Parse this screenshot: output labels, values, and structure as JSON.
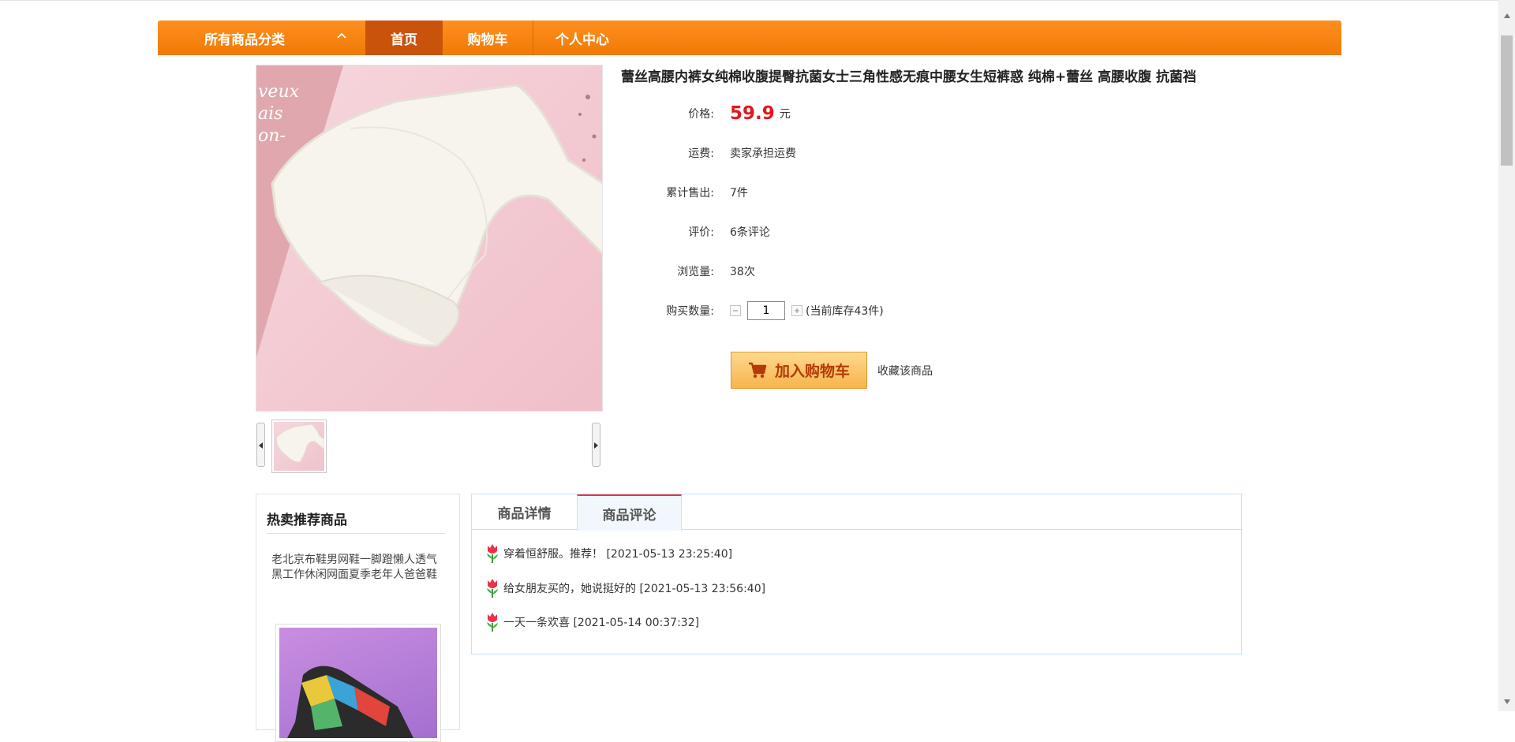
{
  "nav": {
    "category_label": "所有商品分类",
    "items": [
      {
        "label": "首页"
      },
      {
        "label": "购物车"
      },
      {
        "label": "个人中心"
      }
    ]
  },
  "product": {
    "title": "蕾丝高腰内裤女纯棉收腹提臀抗菌女士三角性感无痕中腰女生短裤惑 纯棉+蕾丝 高腰收腹 抗菌裆",
    "image_icon": "product-photo",
    "fields": {
      "price_label": "价格:",
      "price_value": "59.9",
      "price_unit": "元",
      "shipping_label": "运费:",
      "shipping_value": "卖家承担运费",
      "sold_label": "累计售出:",
      "sold_value": "7件",
      "review_label": "评价:",
      "review_value": "6条评论",
      "views_label": "浏览量:",
      "views_value": "38次",
      "qty_label": "购买数量:",
      "qty_value": "1",
      "stock_text": "(当前库存43件)"
    },
    "add_to_cart_label": "加入购物车",
    "favorite_label": "收藏该商品"
  },
  "hot": {
    "title": "热卖推荐商品",
    "item_name": "老北京布鞋男网鞋一脚蹬懒人透气黑工作休闲网面夏季老年人爸爸鞋"
  },
  "tabs": {
    "detail_label": "商品详情",
    "comment_label": "商品评论"
  },
  "comments": [
    {
      "text": "穿着恒舒服。推荐！ [2021-05-13 23:25:40]"
    },
    {
      "text": "给女朋友买的，她说挺好的 [2021-05-13 23:56:40]"
    },
    {
      "text": "一天一条欢喜 [2021-05-14 00:37:32]"
    }
  ],
  "colors": {
    "nav_orange": "#f58412",
    "nav_active": "#c9530a",
    "price_red": "#e4161d",
    "tab_accent": "#e8334a",
    "panel_border": "#c6e2f3"
  }
}
